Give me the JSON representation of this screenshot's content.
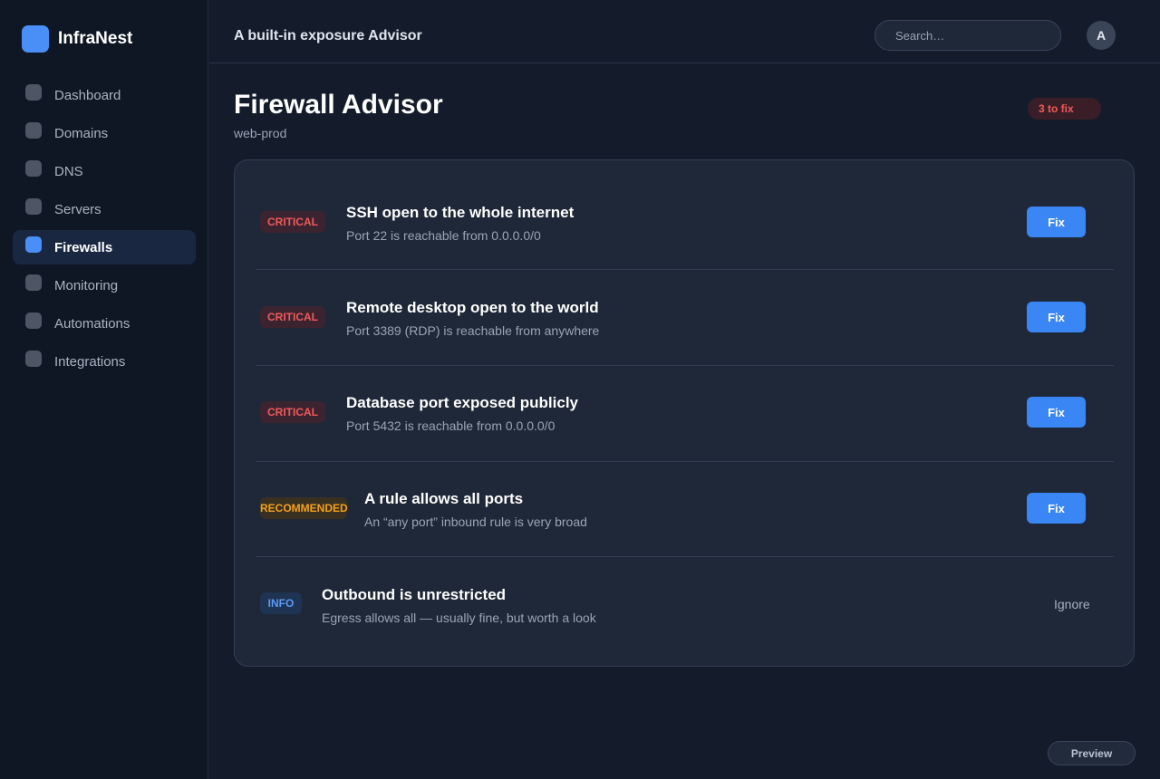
{
  "app": {
    "name": "InfraNest"
  },
  "sidebar": {
    "items": [
      {
        "label": "Dashboard",
        "active": false
      },
      {
        "label": "Domains",
        "active": false
      },
      {
        "label": "DNS",
        "active": false
      },
      {
        "label": "Servers",
        "active": false
      },
      {
        "label": "Firewalls",
        "active": true
      },
      {
        "label": "Monitoring",
        "active": false
      },
      {
        "label": "Automations",
        "active": false
      },
      {
        "label": "Integrations",
        "active": false
      }
    ]
  },
  "topbar": {
    "title": "A built-in exposure Advisor",
    "search_placeholder": "Search…",
    "avatar_initial": "A"
  },
  "page": {
    "title": "Firewall Advisor",
    "subtitle": "web-prod",
    "badge": "3 to fix"
  },
  "findings": [
    {
      "severity": "CRITICAL",
      "title": "SSH open to the whole internet",
      "description": "Port 22 is reachable from 0.0.0.0/0",
      "action": "Fix"
    },
    {
      "severity": "CRITICAL",
      "title": "Remote desktop open to the world",
      "description": "Port 3389 (RDP) is reachable from anywhere",
      "action": "Fix"
    },
    {
      "severity": "CRITICAL",
      "title": "Database port exposed publicly",
      "description": "Port 5432 is reachable from 0.0.0.0/0",
      "action": "Fix"
    },
    {
      "severity": "RECOMMENDED",
      "title": "A rule allows all ports",
      "description": "An “any port” inbound rule is very broad",
      "action": "Fix"
    },
    {
      "severity": "INFO",
      "title": "Outbound is unrestricted",
      "description": "Egress allows all — usually fine, but worth a look",
      "action": "Ignore"
    }
  ],
  "footer": {
    "preview_label": "Preview"
  },
  "colors": {
    "accent": "#3b86f5",
    "critical": "#f05a5a",
    "recommended": "#f3a11c",
    "info": "#5b9bf8"
  }
}
